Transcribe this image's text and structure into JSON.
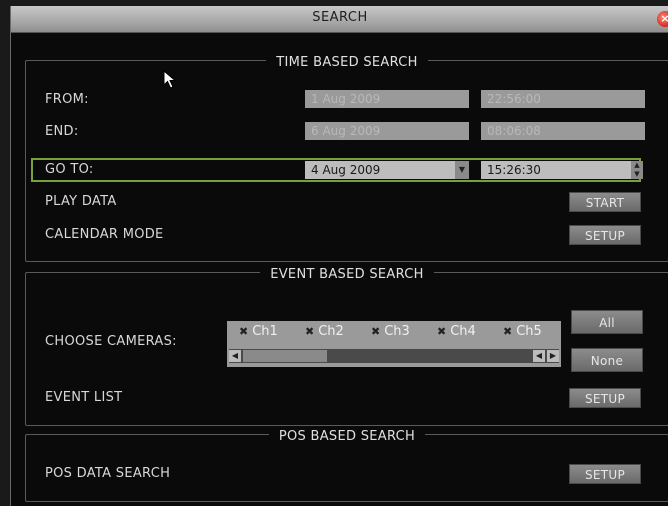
{
  "window": {
    "title": "SEARCH",
    "close_icon": "×"
  },
  "time_search": {
    "title": "TIME BASED SEARCH",
    "from_label": "FROM:",
    "from_date": "1 Aug 2009",
    "from_time": "22:56:00",
    "end_label": "END:",
    "end_date": "6 Aug 2009",
    "end_time": "08:06:08",
    "goto_label": "GO TO:",
    "goto_date": "4 Aug 2009",
    "goto_time": "15:26:30",
    "play_label": "PLAY DATA",
    "start_button": "START",
    "calendar_label": "CALENDAR MODE",
    "calendar_setup": "SETUP"
  },
  "event_search": {
    "title": "EVENT BASED SEARCH",
    "cameras_label": "CHOOSE CAMERAS:",
    "cameras": [
      "Ch1",
      "Ch2",
      "Ch3",
      "Ch4",
      "Ch5"
    ],
    "all_button": "All",
    "none_button": "None",
    "event_list_label": "EVENT LIST",
    "event_list_setup": "SETUP"
  },
  "pos_search": {
    "title": "POS BASED SEARCH",
    "pos_label": "POS DATA SEARCH",
    "pos_setup": "SETUP"
  },
  "colors": {
    "focus_border": "#7aa03a",
    "title_bar": "#b4b4b4",
    "close_button": "#d0281c"
  }
}
